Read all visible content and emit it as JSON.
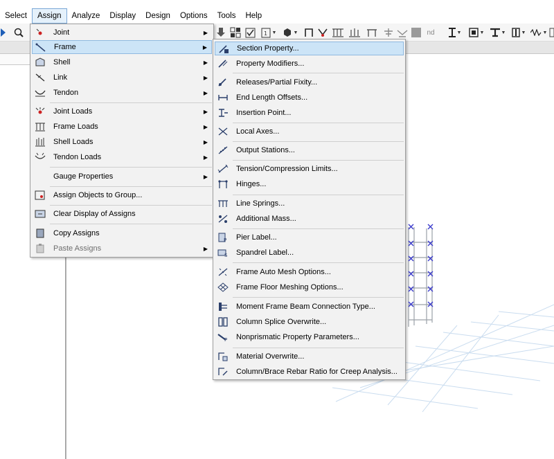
{
  "menubar": {
    "items": [
      "Select",
      "Assign",
      "Analyze",
      "Display",
      "Design",
      "Options",
      "Tools",
      "Help"
    ]
  },
  "toolbar": {
    "nd_label": "nd"
  },
  "assign_menu": {
    "items": [
      {
        "label": "Joint",
        "icon": "joint-icon",
        "submenu": true
      },
      {
        "label": "Frame",
        "icon": "frame-icon",
        "submenu": true,
        "highlighted": true
      },
      {
        "label": "Shell",
        "icon": "shell-icon",
        "submenu": true
      },
      {
        "label": "Link",
        "icon": "link-icon",
        "submenu": true
      },
      {
        "label": "Tendon",
        "icon": "tendon-icon",
        "submenu": true
      },
      {
        "label": "Joint Loads",
        "icon": "joint-loads-icon",
        "submenu": true
      },
      {
        "label": "Frame Loads",
        "icon": "frame-loads-icon",
        "submenu": true
      },
      {
        "label": "Shell Loads",
        "icon": "shell-loads-icon",
        "submenu": true
      },
      {
        "label": "Tendon Loads",
        "icon": "tendon-loads-icon",
        "submenu": true
      },
      {
        "label": "Gauge Properties",
        "icon": "",
        "submenu": true
      },
      {
        "label": "Assign Objects to Group...",
        "icon": "group-icon",
        "submenu": false
      },
      {
        "label": "Clear Display of Assigns",
        "icon": "clear-display-icon",
        "submenu": false
      },
      {
        "label": "Copy Assigns",
        "icon": "copy-icon",
        "submenu": false
      },
      {
        "label": "Paste Assigns",
        "icon": "paste-icon",
        "submenu": true,
        "disabled": true
      }
    ]
  },
  "frame_submenu": {
    "items": [
      {
        "label": "Section Property...",
        "icon": "section-property-icon",
        "highlighted": true
      },
      {
        "label": "Property Modifiers...",
        "icon": "property-modifiers-icon"
      },
      {
        "label": "Releases/Partial Fixity...",
        "icon": "releases-icon"
      },
      {
        "label": "End Length Offsets...",
        "icon": "end-offsets-icon"
      },
      {
        "label": "Insertion Point...",
        "icon": "insertion-point-icon"
      },
      {
        "label": "Local Axes...",
        "icon": "local-axes-icon"
      },
      {
        "label": "Output Stations...",
        "icon": "output-stations-icon"
      },
      {
        "label": "Tension/Compression Limits...",
        "icon": "tension-limits-icon"
      },
      {
        "label": "Hinges...",
        "icon": "hinges-icon"
      },
      {
        "label": "Line Springs...",
        "icon": "line-springs-icon"
      },
      {
        "label": "Additional Mass...",
        "icon": "additional-mass-icon"
      },
      {
        "label": "Pier Label...",
        "icon": "pier-label-icon"
      },
      {
        "label": "Spandrel Label...",
        "icon": "spandrel-label-icon"
      },
      {
        "label": "Frame Auto Mesh Options...",
        "icon": "auto-mesh-icon"
      },
      {
        "label": "Frame Floor Meshing Options...",
        "icon": "floor-meshing-icon"
      },
      {
        "label": "Moment Frame Beam Connection Type...",
        "icon": "beam-connection-icon"
      },
      {
        "label": "Column Splice Overwrite...",
        "icon": "column-splice-icon"
      },
      {
        "label": "Nonprismatic Property Parameters...",
        "icon": "nonprismatic-icon"
      },
      {
        "label": "Material Overwrite...",
        "icon": "material-overwrite-icon"
      },
      {
        "label": "Column/Brace Rebar Ratio for Creep Analysis...",
        "icon": "rebar-ratio-icon"
      }
    ]
  },
  "colors": {
    "highlight": "#cce4f7",
    "highlight_border": "#8fb9e0",
    "joint_marker": "#3a3acc",
    "grid_line": "#b9d3ec"
  }
}
